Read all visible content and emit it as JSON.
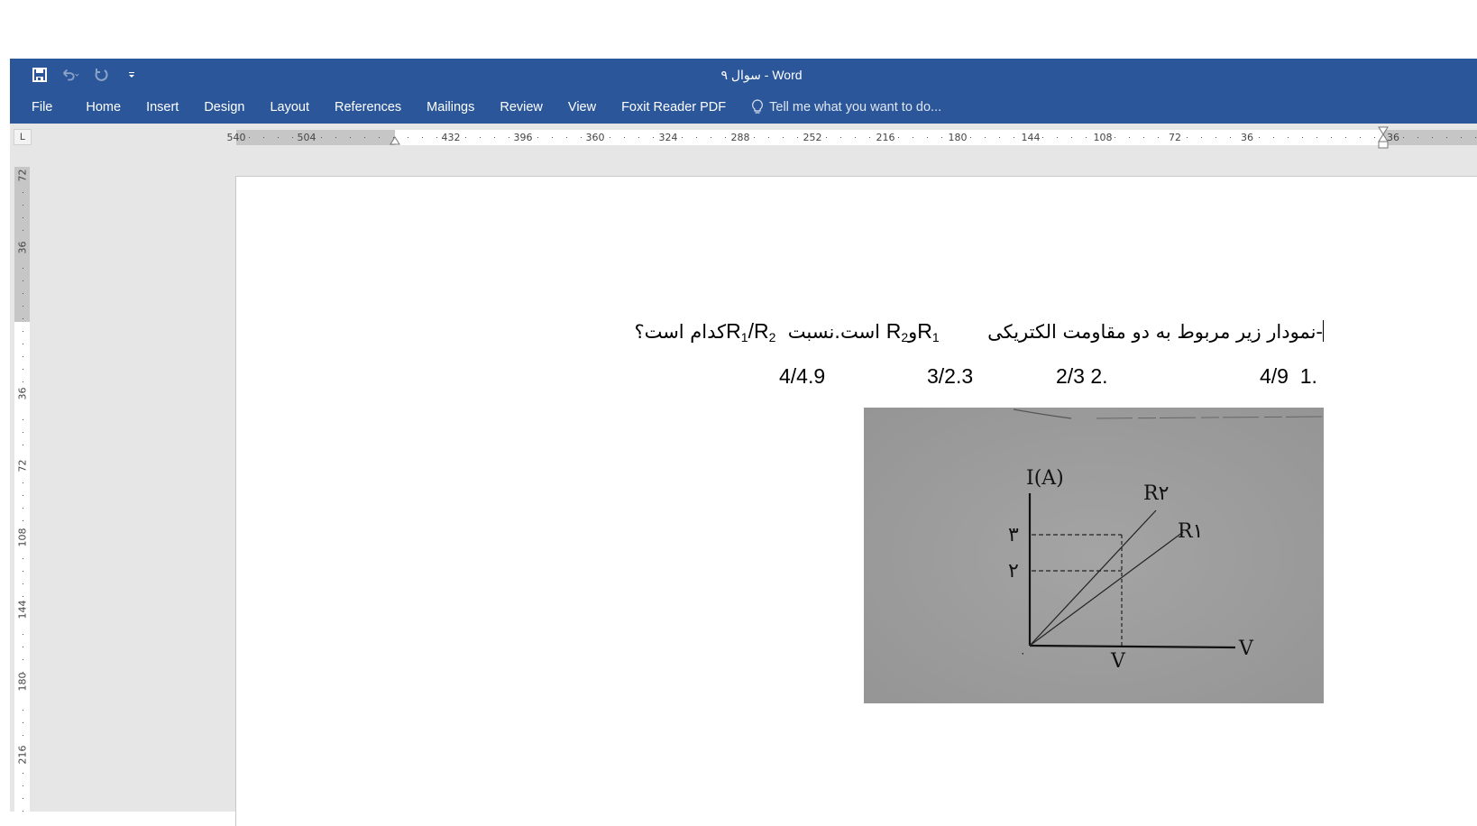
{
  "window": {
    "title": "سوال ۹ - Word",
    "quick_access": [
      {
        "name": "save",
        "icon": "save-icon"
      },
      {
        "name": "undo",
        "icon": "undo-icon",
        "disabled": true
      },
      {
        "name": "redo",
        "icon": "redo-icon",
        "disabled": true
      },
      {
        "name": "customize",
        "icon": "customize-qat-icon"
      }
    ]
  },
  "ribbon": {
    "tabs": [
      "File",
      "Home",
      "Insert",
      "Design",
      "Layout",
      "References",
      "Mailings",
      "Review",
      "View",
      "Foxit Reader PDF"
    ],
    "tell_me_placeholder": "Tell me what you want to do..."
  },
  "rulers": {
    "corner_glyph": "L",
    "horizontal_labels": [
      "540",
      "504",
      "432",
      "396",
      "360",
      "324",
      "288",
      "252",
      "216",
      "180",
      "144",
      "108",
      "72",
      "36",
      "36"
    ],
    "vertical_labels": [
      "72",
      "36",
      "36",
      "72",
      "108",
      "144",
      "180",
      "216"
    ]
  },
  "document": {
    "question": {
      "part1": "-نمودار زیر مربوط به دو مقاومت الکتریکی",
      "r1": "R",
      "r1_sub": "1",
      "and": "و",
      "r2": "R",
      "r2_sub": "2",
      "part2": " است.نسبت ",
      "ratio_r1": "R",
      "ratio_r1_sub": "1",
      "ratio_slash": "/R",
      "ratio_r2_sub": "2",
      "part3": "کدام است؟"
    },
    "options": [
      {
        "number": "1.",
        "text": "4/9"
      },
      {
        "number": "2.",
        "text": "2/3"
      },
      {
        "number": "",
        "text": "3/2.3"
      },
      {
        "number": "",
        "text": "4/4.9"
      }
    ],
    "figure": {
      "y_axis_label": "I(A)",
      "x_axis_label": "V",
      "x_marker_label": "V",
      "origin_label": "۰",
      "y_ticks": [
        "۳",
        "۲"
      ],
      "line_labels": [
        "R۲",
        "R۱"
      ]
    }
  }
}
